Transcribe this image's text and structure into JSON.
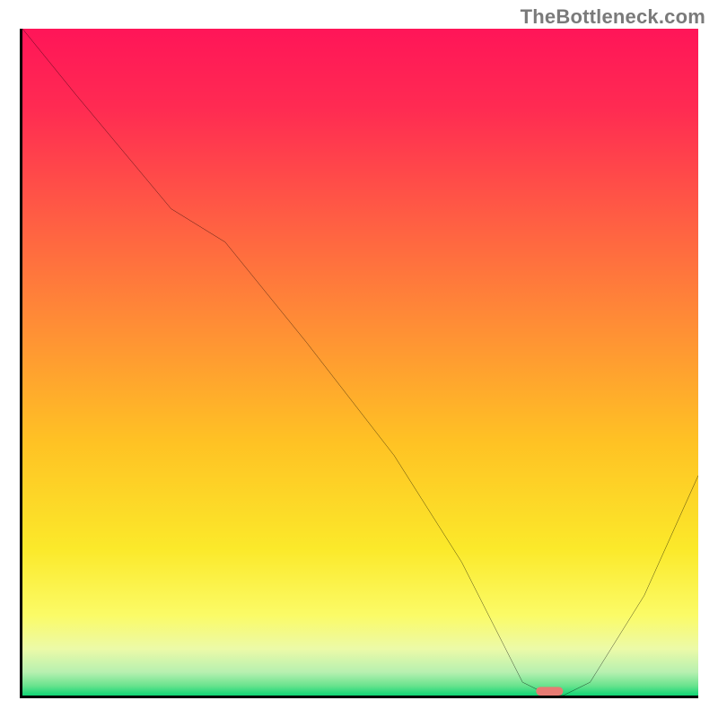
{
  "watermark": "TheBottleneck.com",
  "chart_data": {
    "type": "line",
    "title": "",
    "xlabel": "",
    "ylabel": "",
    "xlim": [
      0,
      100
    ],
    "ylim": [
      0,
      100
    ],
    "grid": false,
    "series": [
      {
        "name": "curve",
        "x": [
          0,
          8,
          22,
          30,
          42,
          55,
          65,
          71,
          74,
          78,
          80,
          84,
          92,
          100
        ],
        "y": [
          100,
          90,
          73,
          68,
          53,
          36,
          20,
          8,
          2,
          0,
          0,
          2,
          15,
          33
        ]
      }
    ],
    "marker": {
      "x": 78,
      "y": 0,
      "width": 4,
      "height": 1.3,
      "color": "#e77b73"
    },
    "background_gradient": {
      "stops": [
        {
          "offset": 0.0,
          "color": "#ff1558"
        },
        {
          "offset": 0.12,
          "color": "#ff2b52"
        },
        {
          "offset": 0.28,
          "color": "#ff5c44"
        },
        {
          "offset": 0.45,
          "color": "#ff8f35"
        },
        {
          "offset": 0.62,
          "color": "#ffc224"
        },
        {
          "offset": 0.78,
          "color": "#fbe92a"
        },
        {
          "offset": 0.88,
          "color": "#fbfb67"
        },
        {
          "offset": 0.93,
          "color": "#ecfaa8"
        },
        {
          "offset": 0.965,
          "color": "#b7f0b0"
        },
        {
          "offset": 0.985,
          "color": "#6ae38e"
        },
        {
          "offset": 1.0,
          "color": "#10d574"
        }
      ]
    }
  }
}
